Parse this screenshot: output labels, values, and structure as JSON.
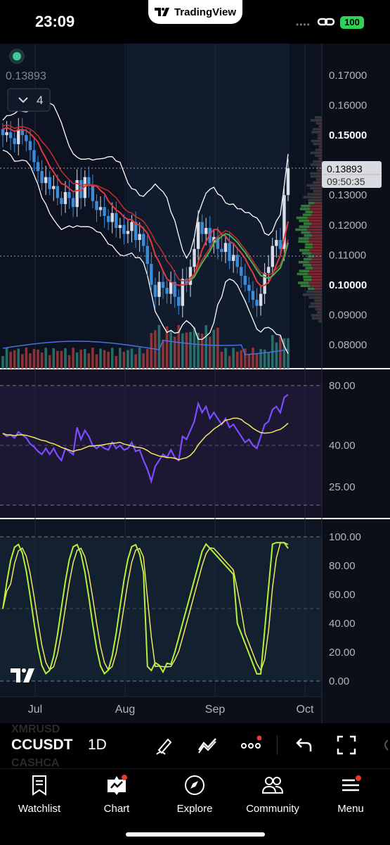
{
  "status_bar": {
    "time": "23:09",
    "app_name": "TradingView",
    "battery": "100",
    "signal_dots": "••••"
  },
  "chart": {
    "last_value_label": "0.13893",
    "collapse_count": "4",
    "price_tag": "0.13893",
    "countdown": "09:50:35",
    "price_axis": [
      "0.17000",
      "0.16000",
      "0.15000",
      "0.14000",
      "0.13000",
      "0.12000",
      "0.11000",
      "0.10000",
      "0.09000",
      "0.08000"
    ],
    "rsi_axis": [
      "80.00",
      "40.00",
      "25.00"
    ],
    "stoch_axis": [
      "100.00",
      "80.00",
      "60.00",
      "40.00",
      "20.00",
      "0.00"
    ],
    "time_axis": [
      "Jul",
      "Aug",
      "Sep",
      "Oct"
    ],
    "colors": {
      "up": "#3a8bd8",
      "down": "#3a6fd0",
      "rsi": "#7c4dff",
      "rsi_ma": "#f5e663",
      "stoch_k": "#b6f23a",
      "stoch_d": "#f5e663",
      "ema_fast": "#e23b3b",
      "ema_slow": "#4caf50",
      "bands": "#ffffff"
    }
  },
  "chart_data": {
    "type": "candlestick",
    "ylim": [
      0.075,
      0.175
    ],
    "last_price": 0.13893,
    "x_labels": [
      "Jul",
      "Aug",
      "Sep",
      "Oct"
    ],
    "close": [
      0.15,
      0.151,
      0.149,
      0.147,
      0.152,
      0.15,
      0.148,
      0.145,
      0.141,
      0.138,
      0.134,
      0.136,
      0.132,
      0.133,
      0.129,
      0.127,
      0.131,
      0.129,
      0.126,
      0.135,
      0.129,
      0.136,
      0.133,
      0.128,
      0.125,
      0.126,
      0.123,
      0.121,
      0.124,
      0.119,
      0.12,
      0.117,
      0.118,
      0.121,
      0.115,
      0.117,
      0.113,
      0.107,
      0.1,
      0.096,
      0.101,
      0.099,
      0.097,
      0.101,
      0.096,
      0.093,
      0.102,
      0.1,
      0.106,
      0.112,
      0.121,
      0.117,
      0.119,
      0.114,
      0.116,
      0.112,
      0.111,
      0.114,
      0.108,
      0.11,
      0.106,
      0.103,
      0.1,
      0.098,
      0.095,
      0.093,
      0.097,
      0.104,
      0.106,
      0.113,
      0.115,
      0.112,
      0.13,
      0.13893
    ],
    "rsi": {
      "values": [
        48,
        46,
        47,
        45,
        49,
        47,
        45,
        41,
        39,
        36,
        34,
        38,
        34,
        38,
        33,
        30,
        38,
        36,
        34,
        52,
        44,
        50,
        46,
        40,
        38,
        40,
        38,
        37,
        42,
        38,
        40,
        37,
        38,
        42,
        36,
        37,
        30,
        24,
        16,
        26,
        30,
        34,
        32,
        37,
        32,
        30,
        46,
        44,
        50,
        56,
        68,
        62,
        66,
        58,
        62,
        58,
        54,
        58,
        52,
        54,
        50,
        46,
        42,
        44,
        40,
        38,
        46,
        54,
        56,
        64,
        66,
        62,
        72,
        74
      ],
      "ma": "rsi_ma"
    },
    "stoch": {
      "k_last": 92,
      "d_last": 86
    },
    "indicators": [
      "Bollinger Bands",
      "EMA",
      "Volume",
      "RSI",
      "Stochastic"
    ]
  },
  "toolbar": {
    "symbol": "CCUSDT",
    "symbol_above": "XMRUSD",
    "symbol_below": "CASHCA",
    "interval": "1D"
  },
  "nav": [
    {
      "label": "Watchlist",
      "icon": "book-icon"
    },
    {
      "label": "Chart",
      "icon": "chart-icon"
    },
    {
      "label": "Explore",
      "icon": "compass-icon"
    },
    {
      "label": "Community",
      "icon": "people-icon"
    },
    {
      "label": "Menu",
      "icon": "menu-icon"
    }
  ]
}
